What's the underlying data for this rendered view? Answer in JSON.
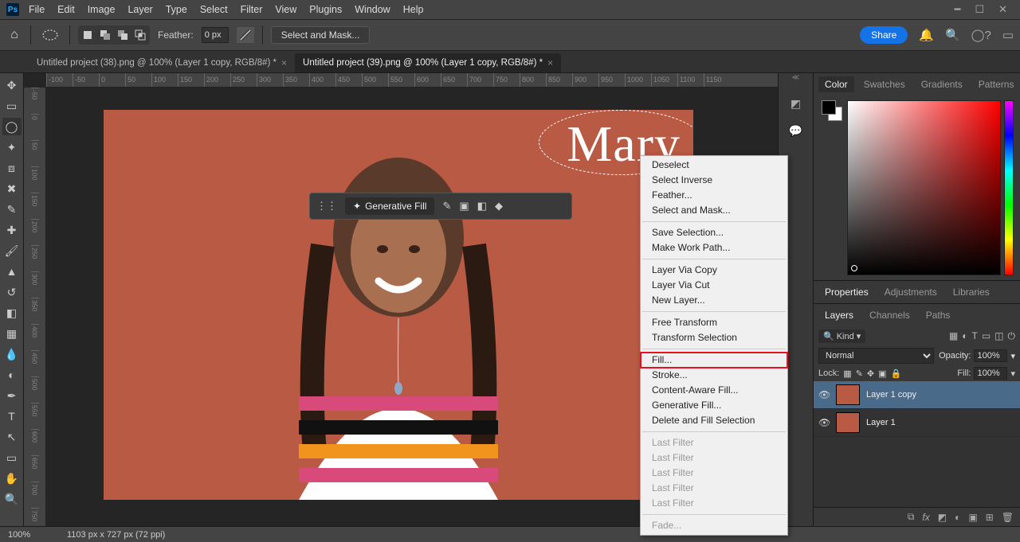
{
  "menubar": {
    "items": [
      "File",
      "Edit",
      "Image",
      "Layer",
      "Type",
      "Select",
      "Filter",
      "View",
      "Plugins",
      "Window",
      "Help"
    ]
  },
  "optionsbar": {
    "feather_label": "Feather:",
    "feather_value": "0 px",
    "select_mask": "Select and Mask...",
    "share": "Share"
  },
  "doc_tabs": [
    {
      "title": "Untitled project (38).png @ 100% (Layer 1 copy, RGB/8#) *",
      "active": false
    },
    {
      "title": "Untitled project (39).png @ 100% (Layer 1 copy, RGB/8#) *",
      "active": true
    }
  ],
  "ruler_h": [
    "-100",
    "-50",
    "0",
    "50",
    "100",
    "150",
    "200",
    "250",
    "300",
    "350",
    "400",
    "450",
    "500",
    "550",
    "600",
    "650",
    "700",
    "750",
    "800",
    "850",
    "900",
    "950",
    "1000",
    "1050",
    "1100",
    "1150"
  ],
  "ruler_v": [
    "-50",
    "0",
    "50",
    "100",
    "150",
    "200",
    "250",
    "300",
    "350",
    "400",
    "450",
    "500",
    "550",
    "600",
    "650",
    "700",
    "750"
  ],
  "canvas_text": "Mary",
  "taskbar": {
    "generative_fill": "Generative Fill"
  },
  "context_menu": {
    "items": [
      {
        "label": "Deselect"
      },
      {
        "label": "Select Inverse"
      },
      {
        "label": "Feather..."
      },
      {
        "label": "Select and Mask..."
      },
      {
        "sep": true
      },
      {
        "label": "Save Selection..."
      },
      {
        "label": "Make Work Path..."
      },
      {
        "sep": true
      },
      {
        "label": "Layer Via Copy"
      },
      {
        "label": "Layer Via Cut"
      },
      {
        "label": "New Layer..."
      },
      {
        "sep": true
      },
      {
        "label": "Free Transform"
      },
      {
        "label": "Transform Selection"
      },
      {
        "sep": true
      },
      {
        "label": "Fill...",
        "highlighted": true
      },
      {
        "label": "Stroke..."
      },
      {
        "label": "Content-Aware Fill..."
      },
      {
        "label": "Generative Fill..."
      },
      {
        "label": "Delete and Fill Selection"
      },
      {
        "sep": true
      },
      {
        "label": "Last Filter",
        "disabled": true
      },
      {
        "label": "Last Filter",
        "disabled": true
      },
      {
        "label": "Last Filter",
        "disabled": true
      },
      {
        "label": "Last Filter",
        "disabled": true
      },
      {
        "label": "Last Filter",
        "disabled": true
      },
      {
        "sep": true
      },
      {
        "label": "Fade...",
        "disabled": true
      }
    ]
  },
  "right_tabs": {
    "color": [
      "Color",
      "Swatches",
      "Gradients",
      "Patterns"
    ],
    "props": [
      "Properties",
      "Adjustments",
      "Libraries"
    ],
    "layers": [
      "Layers",
      "Channels",
      "Paths"
    ]
  },
  "layers": {
    "kind_label": "Kind",
    "blend": "Normal",
    "opacity_label": "Opacity:",
    "opacity_value": "100%",
    "lock_label": "Lock:",
    "fill_label": "Fill:",
    "fill_value": "100%",
    "items": [
      {
        "name": "Layer 1 copy",
        "selected": true
      },
      {
        "name": "Layer 1",
        "selected": false
      }
    ]
  },
  "statusbar": {
    "zoom": "100%",
    "dims": "1103 px x 727 px (72 ppi)"
  }
}
